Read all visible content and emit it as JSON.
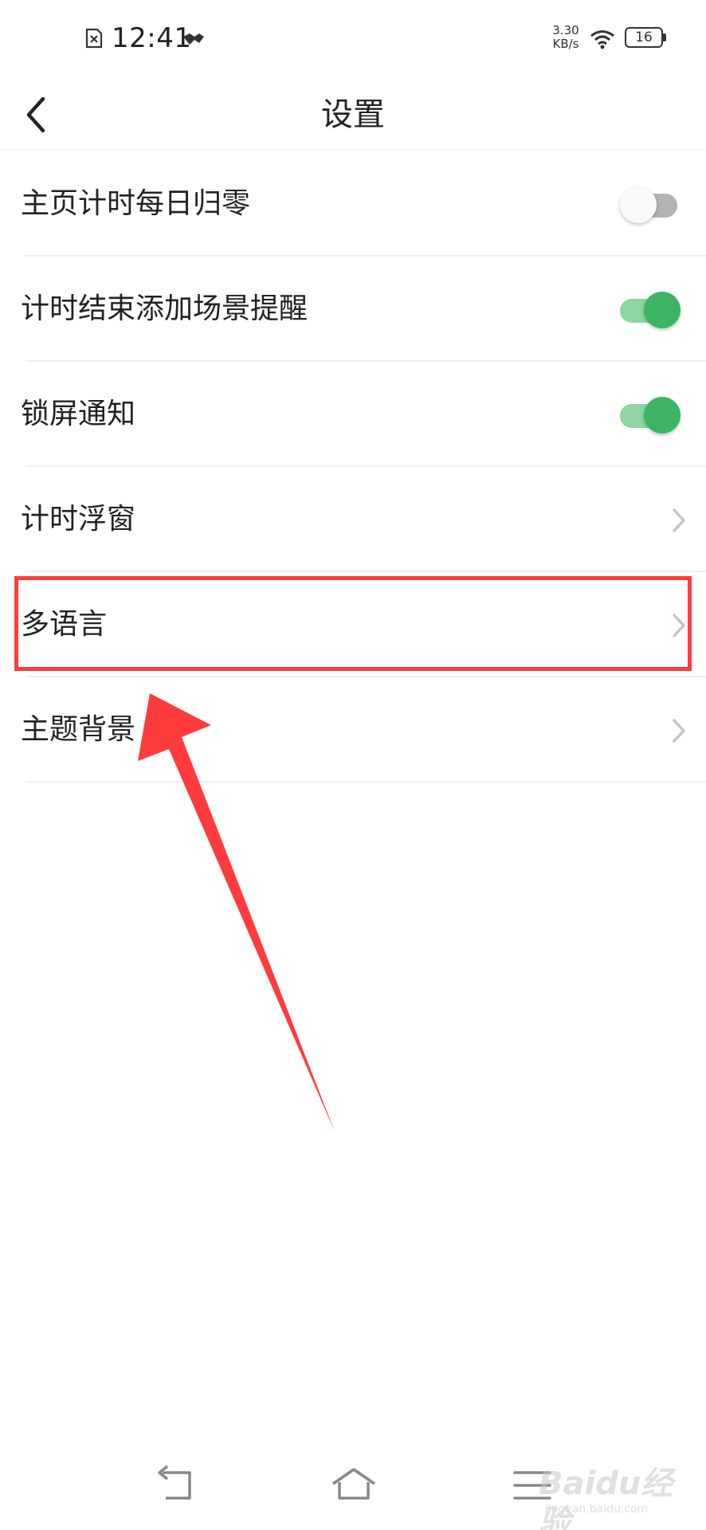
{
  "status_bar": {
    "time": "12:41",
    "speed_value": "3.30",
    "speed_unit": "KB/s",
    "battery_level": "16"
  },
  "header": {
    "title": "设置"
  },
  "settings": {
    "items": [
      {
        "label": "主页计时每日归零",
        "control": "toggle",
        "on": false
      },
      {
        "label": "计时结束添加场景提醒",
        "control": "toggle",
        "on": true
      },
      {
        "label": "锁屏通知",
        "control": "toggle",
        "on": true
      },
      {
        "label": "计时浮窗",
        "control": "chevron"
      },
      {
        "label": "多语言",
        "control": "chevron"
      },
      {
        "label": "主题背景",
        "control": "chevron"
      }
    ]
  },
  "watermark": {
    "brand": "Baidu经验",
    "url": "jingyan.baidu.com"
  },
  "colors": {
    "accent_green": "#3cb463",
    "annotation_red": "#ff3b3b"
  }
}
